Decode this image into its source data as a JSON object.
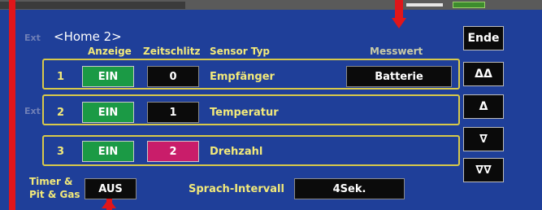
{
  "title": "<Home 2>",
  "headers": {
    "anzeige": "Anzeige",
    "zeitschlitz": "Zeitschlitz",
    "sensor_typ": "Sensor Typ",
    "messwert": "Messwert"
  },
  "ghost_labels": {
    "left_top": "Ext",
    "left_mid": "Ext"
  },
  "rows": [
    {
      "index": "1",
      "anzeige": "EIN",
      "slot": "0",
      "sensor": "Empfänger",
      "messwert": "Batterie"
    },
    {
      "index": "2",
      "anzeige": "EIN",
      "slot": "1",
      "sensor": "Temperatur"
    },
    {
      "index": "3",
      "anzeige": "EIN",
      "slot": "2",
      "sensor": "Drehzahl"
    }
  ],
  "side_buttons": {
    "ende": "Ende",
    "up_fast": "ΔΔ",
    "up": "Δ",
    "down": "∇",
    "down_fast": "∇∇"
  },
  "bottom": {
    "timer_label_line1": "Timer &",
    "timer_label_line2": "Pit & Gas",
    "timer_value": "AUS",
    "interval_label": "Sprach-Intervall",
    "interval_value": "4Sek."
  },
  "colors": {
    "panel": "#1f3f99",
    "accent_yellow": "#f2e97a",
    "on_green": "#1b9a45",
    "active_pink": "#c91d6a",
    "annotation_red": "#e0161a"
  }
}
